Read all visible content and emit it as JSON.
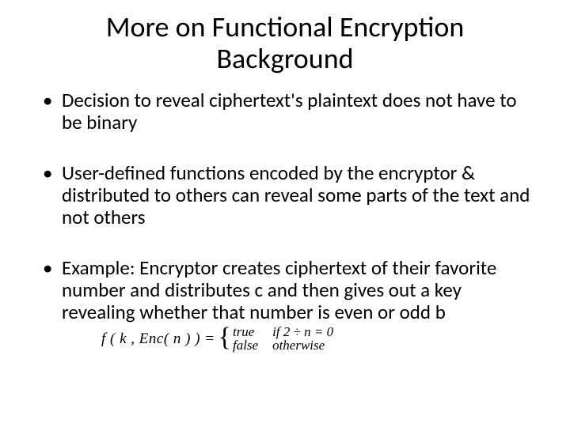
{
  "title_line1": "More on Functional Encryption",
  "title_line2": "Background",
  "bullets": [
    "Decision to reveal ciphertext's plaintext does not have to be binary",
    "User-defined functions encoded by the encryptor & distributed to others can reveal some parts of the text and not others",
    "Example: Encryptor creates ciphertext of their favorite number and distributes c and then gives out a key revealing whether that number is even or odd b"
  ],
  "formula": {
    "lhs": "f ( k , Enc( n ) ) =",
    "case1_val": "true",
    "case1_cond": "if 2 ÷ n = 0",
    "case2_val": "false",
    "case2_cond": "otherwise"
  }
}
